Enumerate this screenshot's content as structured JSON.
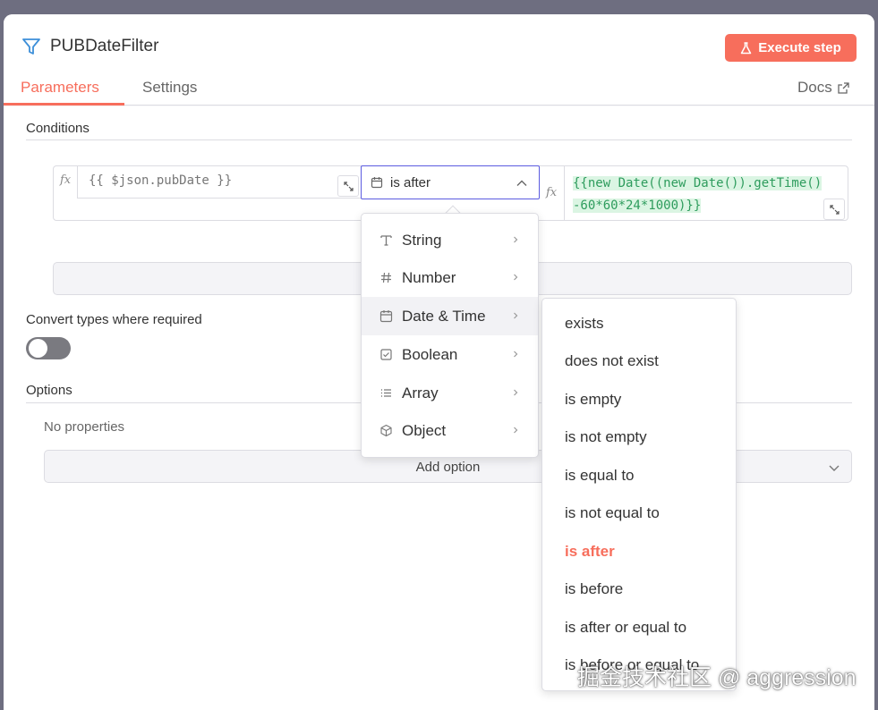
{
  "header": {
    "title": "PUBDateFilter",
    "execute_label": "Execute step",
    "tabs": [
      {
        "label": "Parameters",
        "active": true
      },
      {
        "label": "Settings",
        "active": false
      }
    ],
    "docs_label": "Docs"
  },
  "conditions": {
    "label": "Conditions",
    "left_value": "{{ $json.pubDate }}",
    "operator": "is after",
    "right_value_line1": "{{new Date((new Date()).getTime()",
    "right_value_line2": "-60*60*24*1000)}}",
    "fx_label": "fx"
  },
  "convert": {
    "label": "Convert types where required",
    "enabled": false
  },
  "options": {
    "label": "Options",
    "empty_text": "No properties",
    "add_label": "Add option"
  },
  "type_menu": {
    "items": [
      {
        "label": "String",
        "icon": "text-type-icon"
      },
      {
        "label": "Number",
        "icon": "hash-icon"
      },
      {
        "label": "Date & Time",
        "icon": "calendar-icon",
        "active": true
      },
      {
        "label": "Boolean",
        "icon": "checkbox-icon"
      },
      {
        "label": "Array",
        "icon": "list-icon"
      },
      {
        "label": "Object",
        "icon": "cube-icon"
      }
    ]
  },
  "operator_menu": {
    "items": [
      {
        "label": "exists"
      },
      {
        "label": "does not exist"
      },
      {
        "label": "is empty"
      },
      {
        "label": "is not empty"
      },
      {
        "label": "is equal to"
      },
      {
        "label": "is not equal to"
      },
      {
        "label": "is after",
        "selected": true
      },
      {
        "label": "is before"
      },
      {
        "label": "is after or equal to"
      },
      {
        "label": "is before or equal to"
      }
    ]
  },
  "watermark": "掘金技术社区 @ aggression",
  "colors": {
    "accent": "#f76e5c",
    "focus_border": "#5b5be0",
    "code_green": "#2e9c5d",
    "code_bg": "#dbf5e3"
  }
}
